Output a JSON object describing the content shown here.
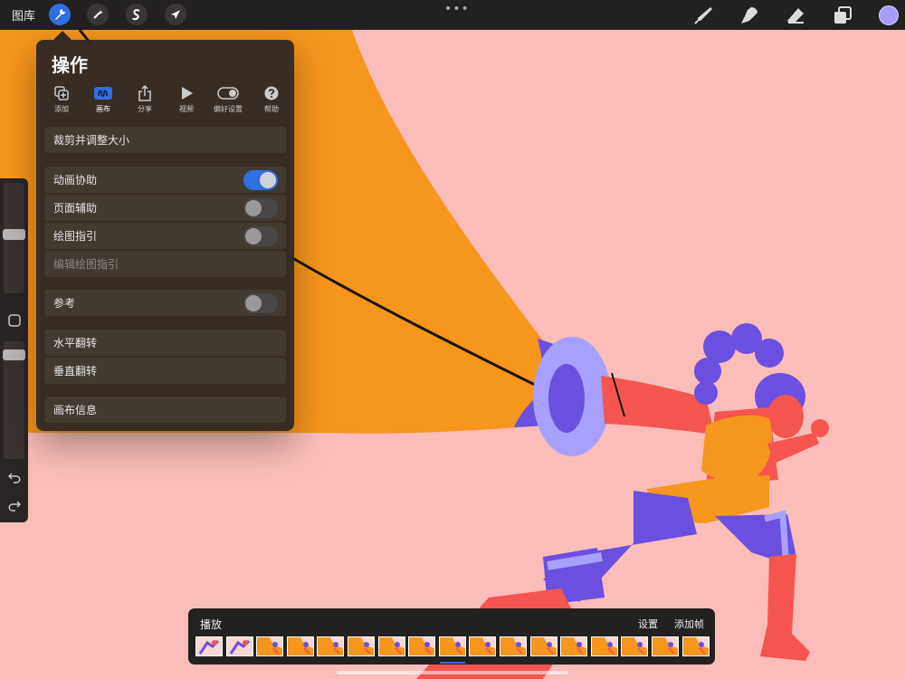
{
  "topbar": {
    "gallery_label": "图库",
    "tools_left": [
      "wrench-icon",
      "magic-wand-icon",
      "selection-s-icon",
      "transform-arrow-icon"
    ],
    "tools_right": [
      "brush-icon",
      "smudge-icon",
      "eraser-icon",
      "layers-icon"
    ],
    "active_color": "#a79cf9"
  },
  "actions": {
    "title": "操作",
    "tabs": [
      {
        "label": "添加",
        "icon": "add-file-icon"
      },
      {
        "label": "画布",
        "icon": "canvas-icon",
        "active": true
      },
      {
        "label": "分享",
        "icon": "share-icon"
      },
      {
        "label": "视频",
        "icon": "play-icon"
      },
      {
        "label": "偏好设置",
        "icon": "toggle-icon"
      },
      {
        "label": "帮助",
        "icon": "help-icon"
      }
    ],
    "items": {
      "crop": "裁剪并调整大小",
      "animation_assist": "动画协助",
      "page_assist": "页面辅助",
      "drawing_guide": "绘图指引",
      "edit_drawing_guide": "编辑绘图指引",
      "reference": "参考",
      "flip_horizontal": "水平翻转",
      "flip_vertical": "垂直翻转",
      "canvas_info": "画布信息"
    },
    "toggles": {
      "animation_assist": true,
      "page_assist": false,
      "drawing_guide": false,
      "reference": false
    }
  },
  "timeline": {
    "play_label": "播放",
    "settings_label": "设置",
    "add_frame_label": "添加帧",
    "frame_count": 17,
    "current_frame": 9
  },
  "colors": {
    "accent": "#2f6fe0",
    "canvas_bg": "#fbbdb9",
    "orange": "#f7961c",
    "purple": "#6b4fe0",
    "lavender": "#a8a0ff",
    "coral": "#f4564f"
  }
}
